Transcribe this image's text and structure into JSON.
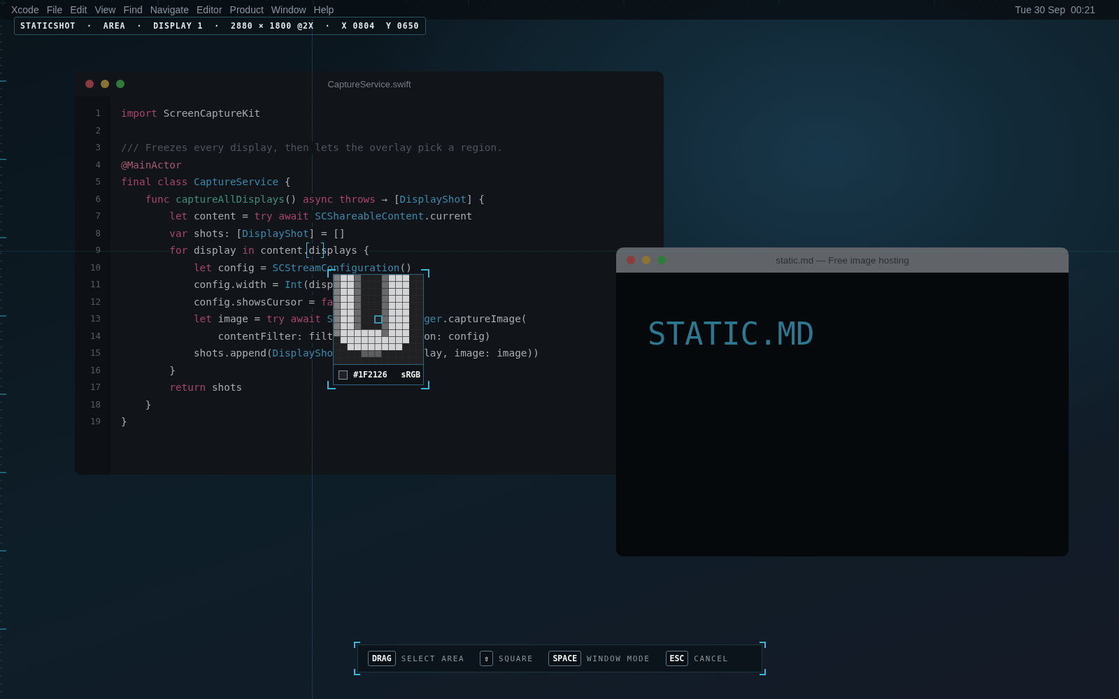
{
  "menu_bar": {
    "items": [
      "Xcode",
      "File",
      "Edit",
      "View",
      "Find",
      "Navigate",
      "Editor",
      "Product",
      "Window",
      "Help"
    ],
    "clock": "Tue 30 Sep  00:21"
  },
  "readout": "STATICSHOT  ·  AREA  ·  DISPLAY 1  ·  2880 × 1800 @2X  ·  X 0804  Y 0650",
  "editor": {
    "title": "CaptureService.swift",
    "lines": [
      {
        "number": "1",
        "tokens": [
          {
            "kind": "keyword",
            "text": "import"
          },
          {
            "kind": "plain",
            "text": " ScreenCaptureKit"
          }
        ]
      },
      {
        "number": "2"
      },
      {
        "number": "3",
        "tokens": [
          {
            "kind": "comment",
            "text": "/// Freezes every display, then lets the overlay pick a region."
          }
        ]
      },
      {
        "number": "4",
        "tokens": [
          {
            "kind": "attribute",
            "text": "@MainActor"
          }
        ]
      },
      {
        "number": "5",
        "tokens": [
          {
            "kind": "keyword",
            "text": "final class "
          },
          {
            "kind": "type",
            "text": "CaptureService"
          },
          {
            "kind": "plain",
            "text": " {"
          }
        ]
      },
      {
        "number": "6",
        "tokens": [
          {
            "kind": "keyword",
            "text": "    func "
          },
          {
            "kind": "function",
            "text": "captureAllDisplays"
          },
          {
            "kind": "plain",
            "text": "() "
          },
          {
            "kind": "keyword",
            "text": "async throws "
          },
          {
            "kind": "plain",
            "text": "→ ["
          },
          {
            "kind": "type",
            "text": "DisplayShot"
          },
          {
            "kind": "plain",
            "text": "] {"
          }
        ]
      },
      {
        "number": "7",
        "tokens": [
          {
            "kind": "keyword",
            "text": "        let "
          },
          {
            "kind": "plain",
            "text": "content = "
          },
          {
            "kind": "keyword",
            "text": "try await "
          },
          {
            "kind": "type",
            "text": "SCShareableContent"
          },
          {
            "kind": "plain",
            "text": ".current"
          }
        ]
      },
      {
        "number": "8",
        "tokens": [
          {
            "kind": "keyword",
            "text": "        var "
          },
          {
            "kind": "plain",
            "text": "shots: ["
          },
          {
            "kind": "type",
            "text": "DisplayShot"
          },
          {
            "kind": "plain",
            "text": "] = []"
          }
        ]
      },
      {
        "number": "9",
        "tokens": [
          {
            "kind": "keyword",
            "text": "        for "
          },
          {
            "kind": "plain",
            "text": "display "
          },
          {
            "kind": "keyword",
            "text": "in "
          },
          {
            "kind": "plain",
            "text": "content."
          },
          {
            "kind": "reticle",
            "text": "di"
          },
          {
            "kind": "plain",
            "text": "splays {"
          }
        ]
      },
      {
        "number": "10",
        "tokens": [
          {
            "kind": "keyword",
            "text": "            let "
          },
          {
            "kind": "plain",
            "text": "config = "
          },
          {
            "kind": "type",
            "text": "SCStreamConfiguration"
          },
          {
            "kind": "plain",
            "text": "()"
          }
        ]
      },
      {
        "number": "11",
        "tokens": [
          {
            "kind": "plain",
            "text": "            config.width = "
          },
          {
            "kind": "type",
            "text": "Int"
          },
          {
            "kind": "plain",
            "text": "(disp"
          }
        ]
      },
      {
        "number": "12",
        "tokens": [
          {
            "kind": "plain",
            "text": "            config.showsCursor = "
          },
          {
            "kind": "keyword",
            "text": "fa"
          }
        ]
      },
      {
        "number": "13",
        "tokens": [
          {
            "kind": "keyword",
            "text": "            let "
          },
          {
            "kind": "plain",
            "text": "image = "
          },
          {
            "kind": "keyword",
            "text": "try await "
          },
          {
            "kind": "type",
            "text": "S"
          }
        ],
        "after_cover": [
          {
            "kind": "type",
            "text": "ger"
          },
          {
            "kind": "plain",
            "text": ".captureImage("
          }
        ]
      },
      {
        "number": "14",
        "tokens": [
          {
            "kind": "plain",
            "text": "                contentFilter: filt"
          }
        ],
        "after_cover": [
          {
            "kind": "plain",
            "text": "on: config)"
          }
        ]
      },
      {
        "number": "15",
        "tokens": [
          {
            "kind": "plain",
            "text": "            shots.append("
          },
          {
            "kind": "type",
            "text": "DisplaySho"
          }
        ],
        "after_cover": [
          {
            "kind": "plain",
            "text": "lay, image: image))"
          }
        ]
      },
      {
        "number": "16",
        "tokens": [
          {
            "kind": "plain",
            "text": "        }"
          }
        ]
      },
      {
        "number": "17",
        "tokens": [
          {
            "kind": "keyword",
            "text": "        return "
          },
          {
            "kind": "plain",
            "text": "shots"
          }
        ]
      },
      {
        "number": "18",
        "tokens": [
          {
            "kind": "plain",
            "text": "    }"
          }
        ]
      },
      {
        "number": "19",
        "tokens": [
          {
            "kind": "plain",
            "text": "}"
          }
        ]
      }
    ]
  },
  "magnifier": {
    "hex": "#1F2126",
    "color_space": "sRGB"
  },
  "browser": {
    "title": "static.md — Free image hosting",
    "heading": "STATIC.MD"
  },
  "hints": [
    {
      "key": "DRAG",
      "label": "SELECT AREA"
    },
    {
      "key": "⇧",
      "label": "SQUARE"
    },
    {
      "key": "SPACE",
      "label": "WINDOW MODE"
    },
    {
      "key": "ESC",
      "label": "CANCEL"
    }
  ]
}
